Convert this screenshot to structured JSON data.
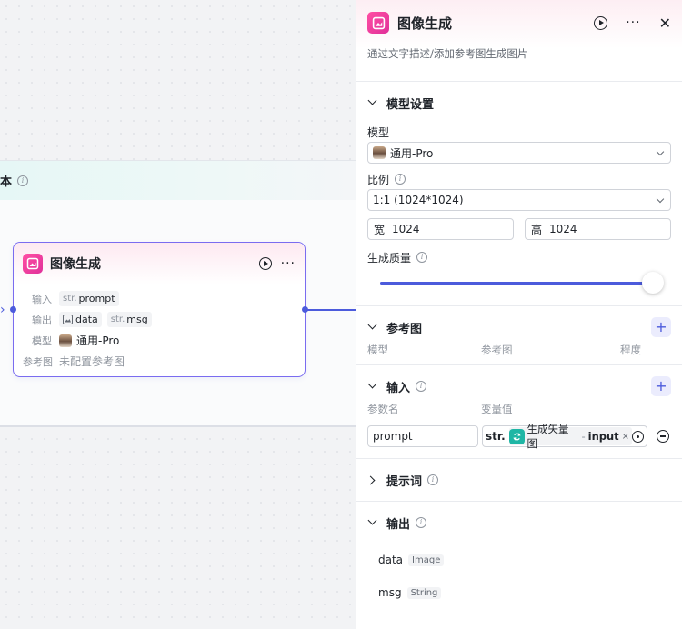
{
  "canvas": {
    "group_title_fragment": "本"
  },
  "node": {
    "title": "图像生成",
    "rows": {
      "input_label": "输入",
      "input_type": "str.",
      "input_name": "prompt",
      "output_label": "输出",
      "output_data": "data",
      "output_msg_type": "str.",
      "output_msg": "msg",
      "model_label": "模型",
      "model_value": "通用-Pro",
      "ref_label": "参考图",
      "ref_value": "未配置参考图"
    }
  },
  "panel": {
    "title": "图像生成",
    "description": "通过文字描述/添加参考图生成图片",
    "model_settings": {
      "title": "模型设置",
      "model_label": "模型",
      "model_value": "通用-Pro",
      "ratio_label": "比例",
      "ratio_value": "1:1 (1024*1024)",
      "width_label": "宽",
      "width_value": "1024",
      "height_label": "高",
      "height_value": "1024",
      "quality_label": "生成质量",
      "quality_fraction": 1.0
    },
    "reference": {
      "title": "参考图",
      "col_model": "模型",
      "col_ref": "参考图",
      "col_degree": "程度",
      "add_label": "+"
    },
    "inputs": {
      "title": "输入",
      "col_param": "参数名",
      "col_value": "变量值",
      "add_label": "+",
      "param_value": "prompt",
      "value_type": "str.",
      "ref_node": "生成矢量图",
      "ref_sep": "-",
      "ref_var": "input",
      "ref_remove": "×"
    },
    "prompt": {
      "title": "提示词"
    },
    "outputs": {
      "title": "输出",
      "items": [
        {
          "name": "data",
          "type": "Image"
        },
        {
          "name": "msg",
          "type": "String"
        }
      ]
    }
  }
}
